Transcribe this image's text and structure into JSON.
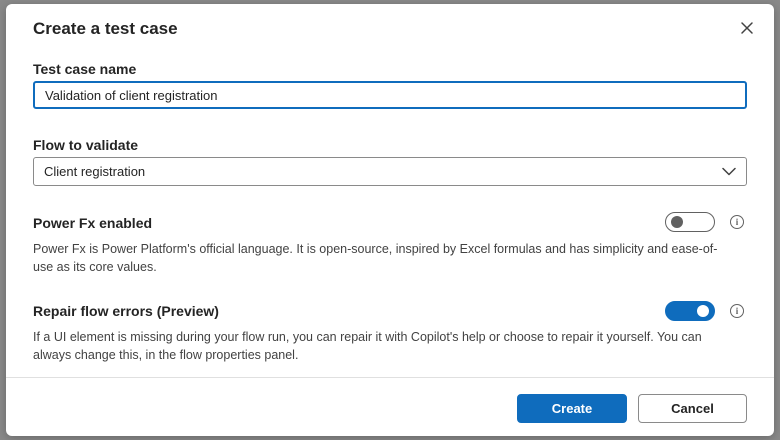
{
  "dialog": {
    "title": "Create a test case",
    "close_icon": "close-icon"
  },
  "test_case_name": {
    "label": "Test case name",
    "value": "Validation of client registration"
  },
  "flow_to_validate": {
    "label": "Flow to validate",
    "selected": "Client registration",
    "icon": "chevron-down-icon"
  },
  "power_fx": {
    "label": "Power Fx enabled",
    "enabled": false,
    "description": "Power Fx is Power Platform's official language. It is open-source, inspired by Excel formulas and has simplicity and ease-of-use as its core values.",
    "info_icon": "info-icon"
  },
  "repair_flow": {
    "label": "Repair flow errors (Preview)",
    "enabled": true,
    "description": "If a UI element is missing during your flow run, you can repair it with Copilot's help or choose to repair it yourself. You can always change this, in the flow properties panel.",
    "info_icon": "info-icon"
  },
  "footer": {
    "create_label": "Create",
    "cancel_label": "Cancel"
  },
  "colors": {
    "accent": "#0f6cbd",
    "toggle_off_border": "#616161",
    "backdrop": "#8a8a8a"
  }
}
